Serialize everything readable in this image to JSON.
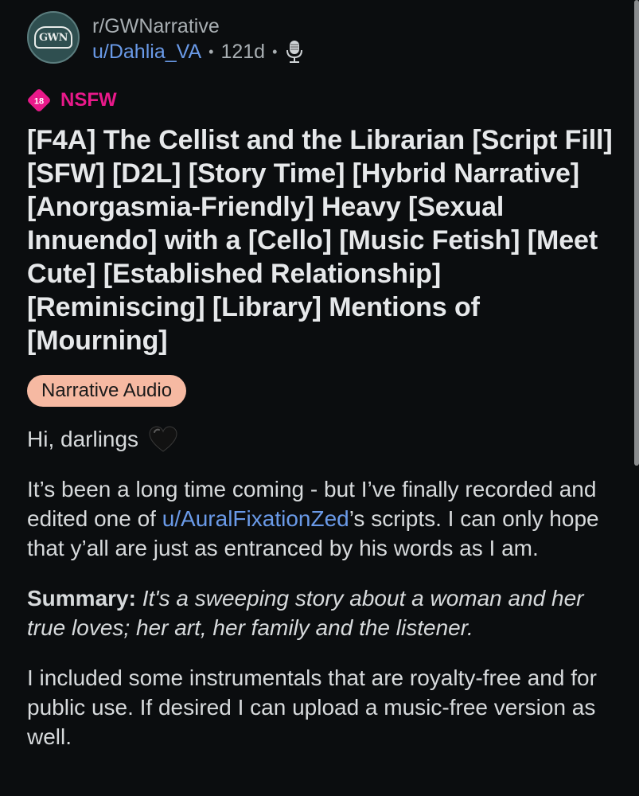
{
  "post": {
    "subreddit": "r/GWNarrative",
    "avatar_text": "GWN",
    "author": "u/Dahlia_VA",
    "separator": "•",
    "age": "121d",
    "flair_icon": "microphone-icon",
    "nsfw_badge_text": "18",
    "nsfw_label": "NSFW",
    "title": "[F4A] The Cellist and the Librarian [Script Fill] [SFW] [D2L] [Story Time] [Hybrid Narrative] [Anorgasmia-Friendly] Heavy [Sexual Innuendo] with a [Cello] [Music Fetish] [Meet Cute] [Established Relationship] [Reminiscing] [Library] Mentions of [Mourning]",
    "link_flair": "Narrative Audio",
    "body": {
      "greeting": "Hi, darlings",
      "greeting_emoji": "black-heart-icon",
      "p1_before": "It’s been a long time coming - but I’ve finally recorded and edited one of ",
      "p1_link": "u/AuralFixationZed",
      "p1_after": "’s scripts. I can only hope that y’all are just as entranced by his words as I am.",
      "summary_label": "Summary:",
      "summary_text": "It's a sweeping story about a woman and her true loves; her art, her family and the listener.",
      "p3": "I included some instrumentals that are royalty-free and for public use. If desired I can upload a music-free version as well."
    }
  },
  "colors": {
    "background": "#0b0d0f",
    "link": "#6a9ae8",
    "nsfw": "#e9198a",
    "flair_bg": "#f6b9a2"
  }
}
